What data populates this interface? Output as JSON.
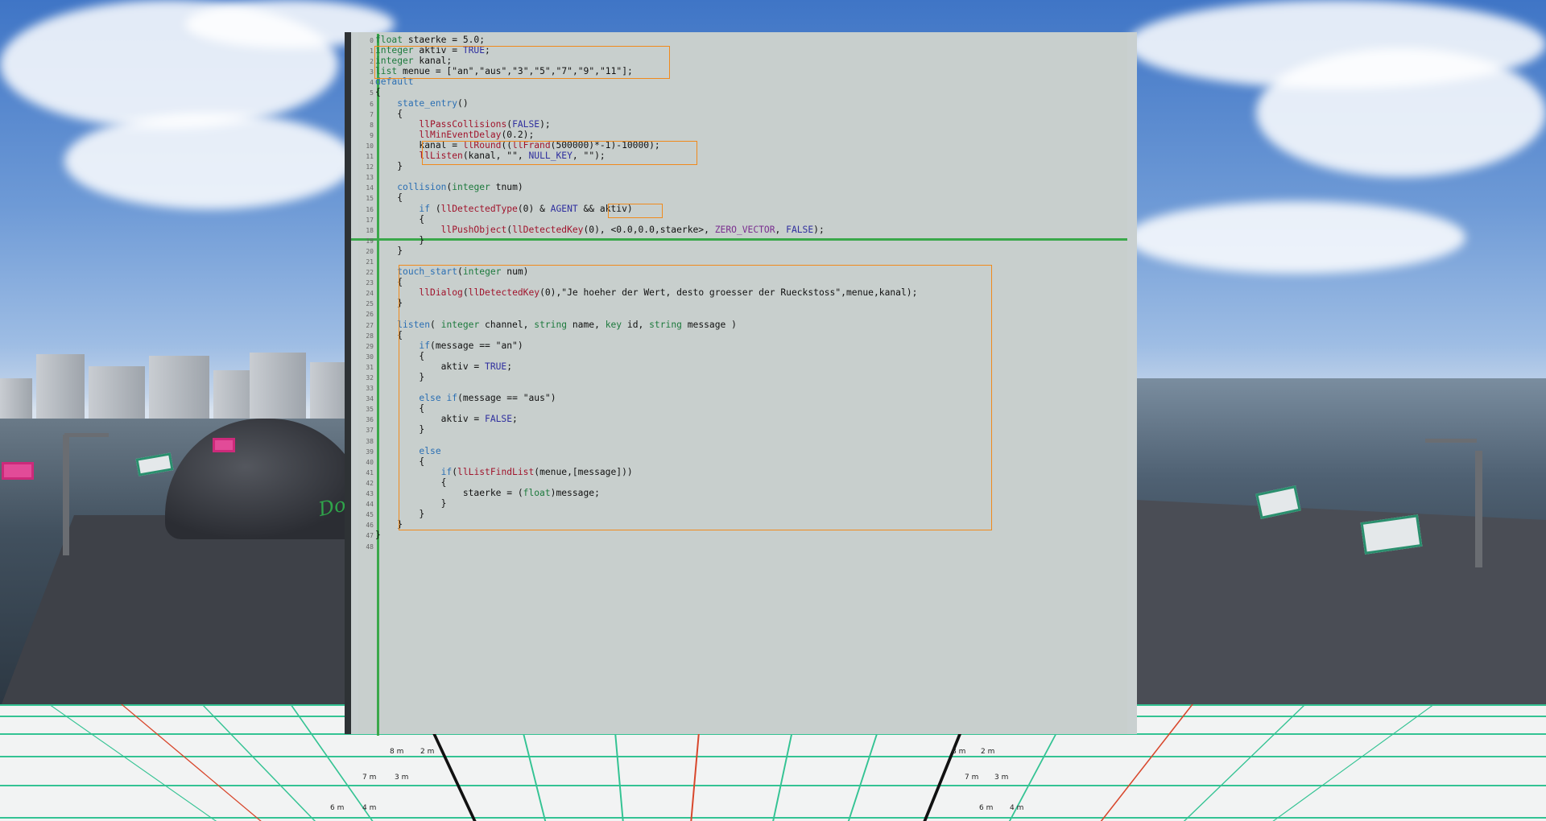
{
  "scene": {
    "building_sign": "Doku K",
    "ruler_labels": [
      "8 m",
      "2 m",
      "7 m",
      "3 m",
      "6 m",
      "4 m"
    ]
  },
  "code_lines": [
    "float staerke = 5.0;",
    "integer aktiv = TRUE;",
    "integer kanal;",
    "list menue = [\"an\",\"aus\",\"3\",\"5\",\"7\",\"9\",\"11\"];",
    "default",
    "{",
    "    state_entry()",
    "    {",
    "        llPassCollisions(FALSE);",
    "        llMinEventDelay(0.2);",
    "        kanal = llRound((llFrand(500000)*-1)-10000);",
    "        llListen(kanal, \"\", NULL_KEY, \"\");",
    "    }",
    "",
    "    collision(integer tnum)",
    "    {",
    "        if (llDetectedType(0) & AGENT && aktiv)",
    "        {",
    "            llPushObject(llDetectedKey(0), <0.0,0.0,staerke>, ZERO_VECTOR, FALSE);",
    "        }",
    "    }",
    "",
    "    touch_start(integer num)",
    "    {",
    "        llDialog(llDetectedKey(0),\"Je hoeher der Wert, desto groesser der Rueckstoss\",menue,kanal);",
    "    }",
    "",
    "    listen( integer channel, string name, key id, string message )",
    "    {",
    "        if(message == \"an\")",
    "        {",
    "            aktiv = TRUE;",
    "        }",
    "",
    "        else if(message == \"aus\")",
    "        {",
    "            aktiv = FALSE;",
    "        }",
    "",
    "        else",
    "        {",
    "            if(llListFindList(menue,[message]))",
    "            {",
    "                staerke = (float)message;",
    "            }",
    "        }",
    "    }",
    "}",
    ""
  ],
  "colors": {
    "highlight_box": "#f08a1c",
    "gutter": "#3aa84a",
    "keyword": "#2b6fb3",
    "type": "#1d7a3d",
    "function": "#a0142c"
  }
}
